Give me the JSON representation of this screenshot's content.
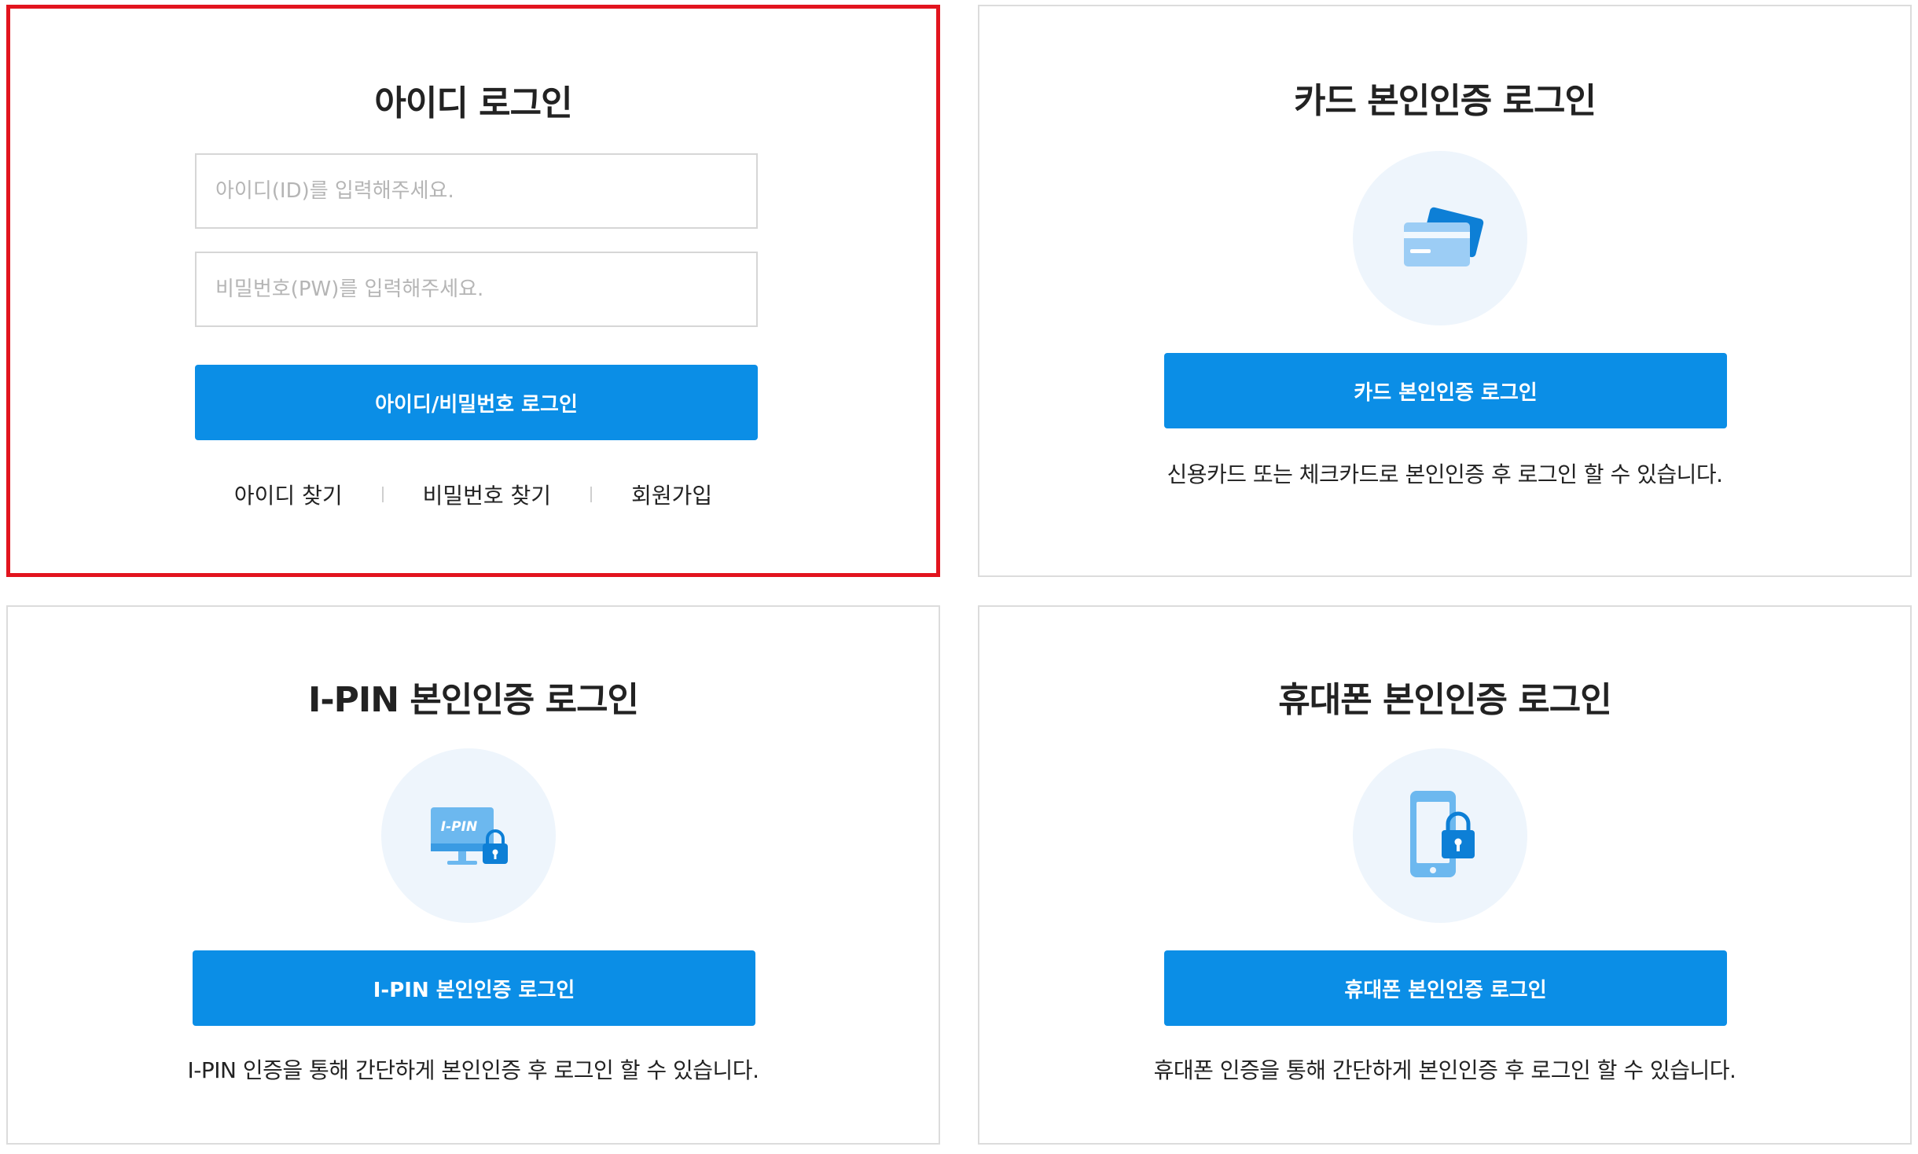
{
  "id_login": {
    "title": "아이디 로그인",
    "id_placeholder": "아이디(ID)를 입력해주세요.",
    "pw_placeholder": "비밀번호(PW)를 입력해주세요.",
    "login_button": "아이디/비밀번호 로그인",
    "links": [
      "아이디 찾기",
      "비밀번호 찾기",
      "회원가입"
    ]
  },
  "card_login": {
    "title": "카드 본인인증 로그인",
    "button": "카드 본인인증 로그인",
    "description": "신용카드 또는 체크카드로 본인인증 후 로그인 할 수 있습니다.",
    "icon": "credit-card-icon"
  },
  "ipin_login": {
    "title": "I-PIN 본인인증 로그인",
    "button": "I-PIN 본인인증 로그인",
    "description": "I-PIN 인증을 통해 간단하게 본인인증 후 로그인 할 수 있습니다.",
    "icon": "ipin-monitor-lock-icon",
    "icon_text": "I-PIN"
  },
  "phone_login": {
    "title": "휴대폰 본인인증 로그인",
    "button": "휴대폰 본인인증 로그인",
    "description": "휴대폰 인증을 통해 간단하게 본인인증 후 로그인 할 수 있습니다.",
    "icon": "phone-lock-icon"
  },
  "colors": {
    "primary_button": "#0b8ee6",
    "active_border": "#e2141e",
    "icon_background": "#eef5fc",
    "panel_border": "#dcdcdc"
  }
}
